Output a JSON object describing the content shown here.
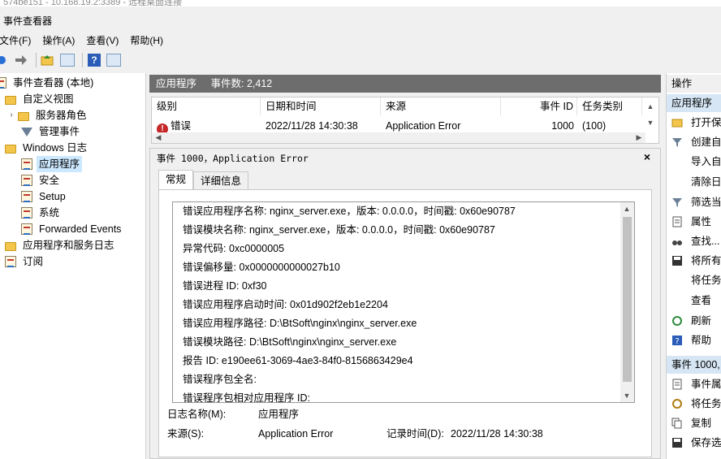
{
  "window": {
    "title": "574be151 - 10.168.19.2:3389 - 远程桌面连接",
    "app_name": "事件查看器"
  },
  "menu": [
    "文件(F)",
    "操作(A)",
    "查看(V)",
    "帮助(H)"
  ],
  "toolbar": {
    "back_icon": "back-arrow-icon",
    "forward_icon": "forward-arrow-icon",
    "help_glyph": "?"
  },
  "tree": {
    "root": "事件查看器 (本地)",
    "custom_views": "自定义视图",
    "server_roles": "服务器角色",
    "admin_events": "管理事件",
    "windows_logs": "Windows 日志",
    "application": "应用程序",
    "security": "安全",
    "setup": "Setup",
    "system": "系统",
    "forwarded": "Forwarded Events",
    "app_service_logs": "应用程序和服务日志",
    "subscriptions": "订阅"
  },
  "log_header": {
    "name": "应用程序",
    "count_label": "事件数: 2,412"
  },
  "grid": {
    "columns": [
      "级别",
      "日期和时间",
      "来源",
      "事件 ID",
      "任务类别"
    ],
    "row": {
      "level": "错误",
      "datetime": "2022/11/28 14:30:38",
      "source": "Application Error",
      "event_id": "1000",
      "task_category": "(100)"
    }
  },
  "detail": {
    "title": "事件 1000，Application Error",
    "close": "×",
    "tabs": [
      "常规",
      "详细信息"
    ],
    "lines": [
      "错误应用程序名称: nginx_server.exe，版本: 0.0.0.0，时间戳: 0x60e90787",
      "错误模块名称: nginx_server.exe，版本: 0.0.0.0，时间戳: 0x60e90787",
      "异常代码: 0xc0000005",
      "错误偏移量: 0x0000000000027b10",
      "错误进程 ID: 0xf30",
      "错误应用程序启动时间: 0x01d902f2eb1e2204",
      "错误应用程序路径: D:\\BtSoft\\nginx\\nginx_server.exe",
      "错误模块路径: D:\\BtSoft\\nginx\\nginx_server.exe",
      "报告 ID: e190ee61-3069-4ae3-84f0-8156863429e4",
      "错误程序包全名:",
      "错误程序包相对应用程序 ID:"
    ],
    "meta": {
      "log_name_label": "日志名称(M):",
      "log_name_value": "应用程序",
      "source_label": "来源(S):",
      "source_value": "Application Error",
      "logged_label": "记录时间(D):",
      "logged_value": "2022/11/28 14:30:38"
    }
  },
  "actions": {
    "header": "操作",
    "section1": "应用程序",
    "items1": [
      "打开保",
      "创建自",
      "导入自",
      "清除日",
      "筛选当",
      "属性",
      "查找...",
      "将所有",
      "将任务",
      "查看",
      "刷新",
      "帮助"
    ],
    "section2": "事件 1000,",
    "items2": [
      "事件属",
      "将任务",
      "复制",
      "保存选"
    ]
  }
}
